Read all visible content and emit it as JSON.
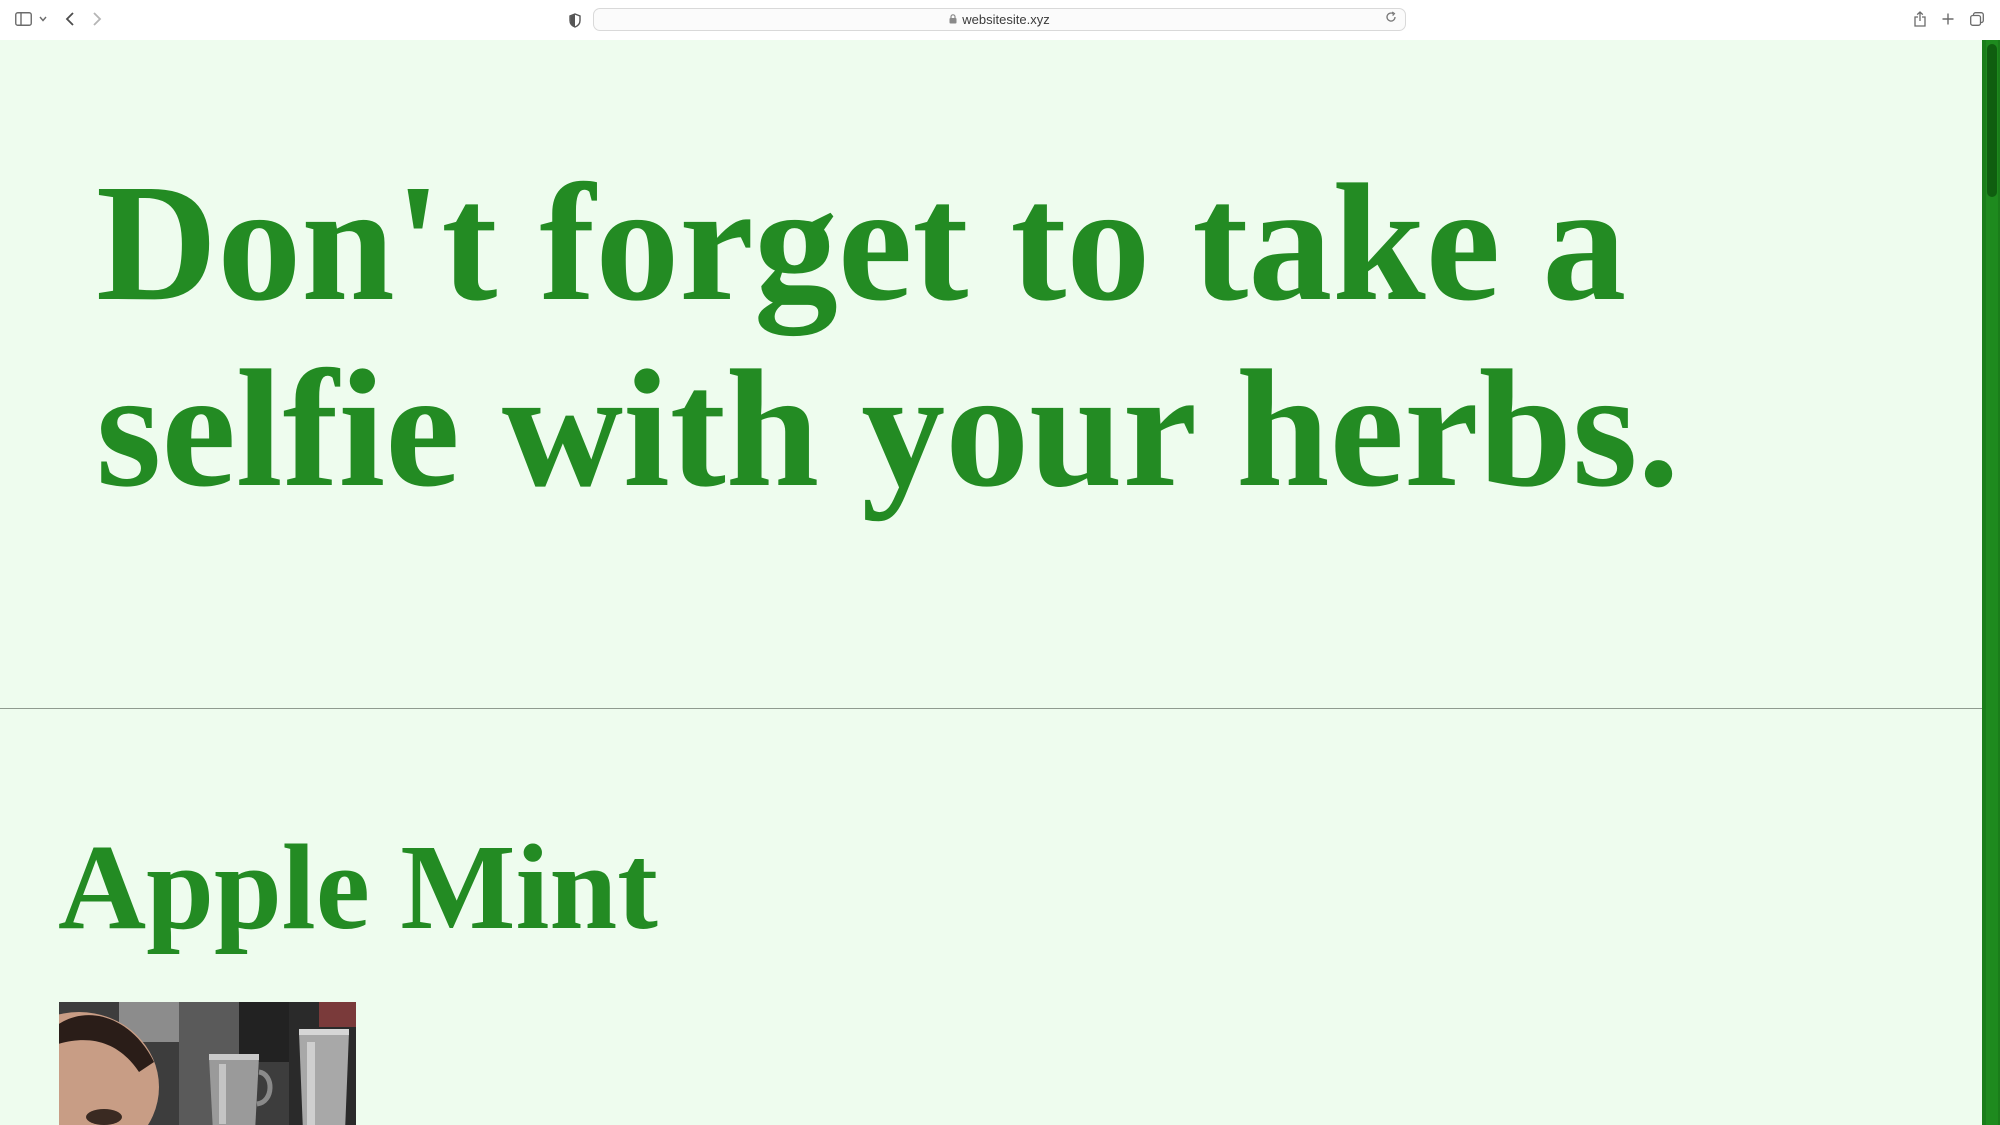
{
  "browser": {
    "url": "websitesite.xyz"
  },
  "page": {
    "hero_title": "Don't forget to take a selfie with your herbs.",
    "section_title": "Apple Mint"
  },
  "colors": {
    "background": "#eefcee",
    "text": "#238b23",
    "scrollbar": "#1e8a1e"
  },
  "icons": {
    "sidebar": "sidebar-icon",
    "back": "chevron-left-icon",
    "forward": "chevron-right-icon",
    "privacy": "shield-icon",
    "lock": "lock-icon",
    "reload": "reload-icon",
    "share": "share-icon",
    "new_tab": "plus-icon",
    "tabs": "tabs-overview-icon"
  }
}
